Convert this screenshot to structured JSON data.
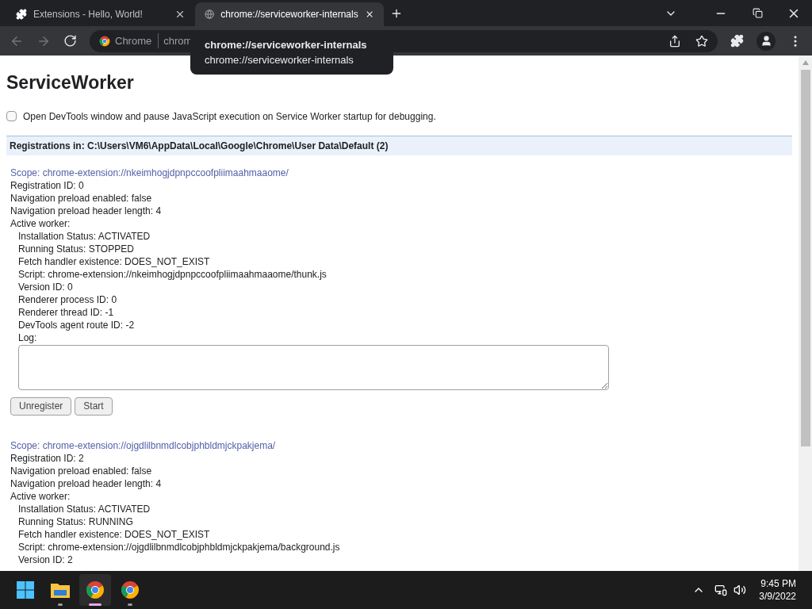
{
  "tabs": [
    {
      "title": "Extensions - Hello, World!",
      "kind": "extension",
      "selected": false
    },
    {
      "title": "chrome://serviceworker-internals",
      "kind": "page",
      "selected": true
    }
  ],
  "address_bar": {
    "chip": "Chrome",
    "url": "chrom"
  },
  "tooltip": {
    "title": "chrome://serviceworker-internals",
    "url": "chrome://serviceworker-internals"
  },
  "page": {
    "title": "ServiceWorker",
    "debug_option": {
      "label": "Open DevTools window and pause JavaScript execution on Service Worker startup for debugging.",
      "checked": false
    },
    "registrations_header": "Registrations in: C:\\Users\\VM6\\AppData\\Local\\Google\\Chrome\\User Data\\Default (2)",
    "registrations": [
      {
        "scope": "Scope: chrome-extension://nkeimhogjdpnpccoofpliimaahmaaome/",
        "details": [
          "Registration ID: 0",
          "Navigation preload enabled: false",
          "Navigation preload header length: 4",
          "Active worker:"
        ],
        "worker": [
          "Installation Status: ACTIVATED",
          "Running Status: STOPPED",
          "Fetch handler existence: DOES_NOT_EXIST",
          "Script: chrome-extension://nkeimhogjdpnpccoofpliimaahmaaome/thunk.js",
          "Version ID: 0",
          "Renderer process ID: 0",
          "Renderer thread ID: -1",
          "DevTools agent route ID: -2"
        ],
        "log_label": "Log:",
        "buttons": [
          "Unregister",
          "Start"
        ]
      },
      {
        "scope": "Scope: chrome-extension://ojgdlilbnmdlcobjphbldmjckpakjema/",
        "details": [
          "Registration ID: 2",
          "Navigation preload enabled: false",
          "Navigation preload header length: 4",
          "Active worker:"
        ],
        "worker": [
          "Installation Status: ACTIVATED",
          "Running Status: RUNNING",
          "Fetch handler existence: DOES_NOT_EXIST",
          "Script: chrome-extension://ojgdlilbnmdlcobjphbldmjckpakjema/background.js",
          "Version ID: 2"
        ]
      }
    ]
  },
  "taskbar": {
    "apps": [
      {
        "kind": "start",
        "selected": false,
        "open": false
      },
      {
        "kind": "folder",
        "selected": false,
        "open": true
      },
      {
        "kind": "chrome",
        "selected": true,
        "open": true
      },
      {
        "kind": "chrome",
        "selected": false,
        "open": true
      }
    ],
    "time": "9:45 PM",
    "date": "3/9/2022"
  }
}
